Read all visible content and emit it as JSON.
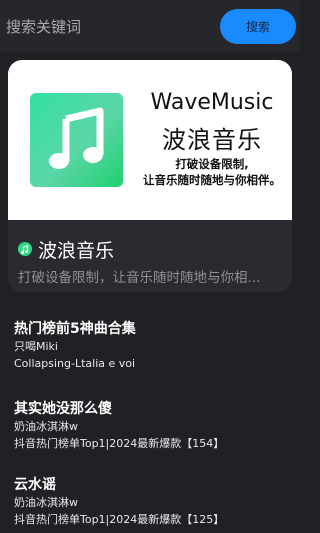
{
  "search": {
    "placeholder": "搜索关键词",
    "button_label": "搜索"
  },
  "featured": {
    "banner_title_en": "WaveMusic",
    "banner_title_cn": "波浪音乐",
    "banner_slogan_line1": "打破设备限制,",
    "banner_slogan_line2": "让音乐随时随地与你相伴。",
    "app_icon": "music-note-icon",
    "app_name": "波浪音乐",
    "app_desc": "打破设备限制，让音乐随时随地与你相..."
  },
  "songs": [
    {
      "title": "热门榜前5神曲合集",
      "artist": "只喝Miki",
      "album": "Collapsing-Ltalia e voi"
    },
    {
      "title": "其实她没那么傻",
      "artist": "奶油冰淇淋w",
      "album": "抖音热门榜单Top1|2024最新爆款【154】"
    },
    {
      "title": "云水谣",
      "artist": "奶油冰淇淋w",
      "album": "抖音热门榜单Top1|2024最新爆款【125】"
    }
  ],
  "colors": {
    "background": "#202125",
    "accent": "#1a8bff",
    "logo_green": "#2fd882"
  }
}
